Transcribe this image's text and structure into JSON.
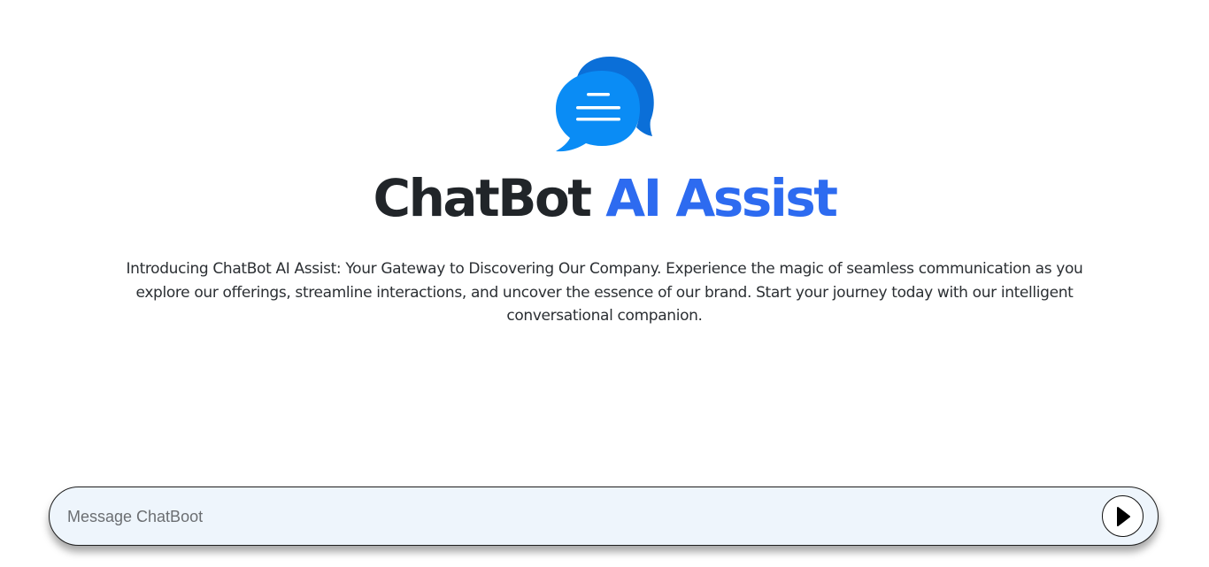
{
  "hero": {
    "title_main": "ChatBot",
    "title_accent": "AI Assist",
    "intro": "Introducing ChatBot AI Assist: Your Gateway to Discovering Our Company. Experience the magic of seamless communication as you explore our offerings, streamline interactions, and uncover the essence of our brand. Start your journey today with our intelligent conversational companion.",
    "logo_icon": "chat-bubbles-icon"
  },
  "composer": {
    "placeholder": "Message ChatBoot",
    "value": "",
    "send_icon": "play-icon"
  },
  "colors": {
    "title": "#212529",
    "accent": "#2d6bf0",
    "logo_back_bubble": "#0b6fd8",
    "logo_front_bubble": "#0a8cf5",
    "input_background": "#eef5fc"
  }
}
